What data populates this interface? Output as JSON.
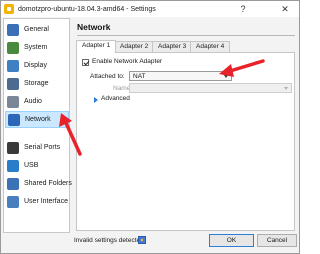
{
  "window": {
    "title": "domotzpro-ubuntu-18.04.3-amd64 - Settings",
    "help_glyph": "?",
    "close_glyph": "✕"
  },
  "sidebar": {
    "items": [
      {
        "label": "General",
        "icon": "general-icon",
        "color": "#3b6fb6",
        "selected": false
      },
      {
        "label": "System",
        "icon": "system-icon",
        "color": "#4a8a3c",
        "selected": false
      },
      {
        "label": "Display",
        "icon": "display-icon",
        "color": "#3f7fc4",
        "selected": false
      },
      {
        "label": "Storage",
        "icon": "storage-icon",
        "color": "#4d6b8f",
        "selected": false
      },
      {
        "label": "Audio",
        "icon": "audio-icon",
        "color": "#7a8796",
        "selected": false
      },
      {
        "label": "Network",
        "icon": "network-icon",
        "color": "#2c66b8",
        "selected": true
      },
      {
        "label": "Serial Ports",
        "icon": "serial-ports-icon",
        "color": "#3a3a3a",
        "selected": false
      },
      {
        "label": "USB",
        "icon": "usb-icon",
        "color": "#2a7dc9",
        "selected": false
      },
      {
        "label": "Shared Folders",
        "icon": "shared-folders-icon",
        "color": "#3d72b8",
        "selected": false
      },
      {
        "label": "User Interface",
        "icon": "user-interface-icon",
        "color": "#4a7fbf",
        "selected": false
      }
    ]
  },
  "main": {
    "title": "Network",
    "tabs": [
      {
        "label": "Adapter 1",
        "active": true
      },
      {
        "label": "Adapter 2",
        "active": false
      },
      {
        "label": "Adapter 3",
        "active": false
      },
      {
        "label": "Adapter 4",
        "active": false
      }
    ],
    "enable_adapter_label": "Enable Network Adapter",
    "enable_adapter_checked": true,
    "attached_to_label": "Attached to:",
    "attached_to_value": "NAT",
    "name_label": "Name:",
    "name_value": "",
    "advanced_label": "Advanced"
  },
  "footer": {
    "status": "Invalid settings detected",
    "ok_label": "OK",
    "cancel_label": "Cancel"
  },
  "colors": {
    "accent": "#2b7fd9",
    "selection": "#cce8ff",
    "annotation_arrow": "#e8222a"
  }
}
